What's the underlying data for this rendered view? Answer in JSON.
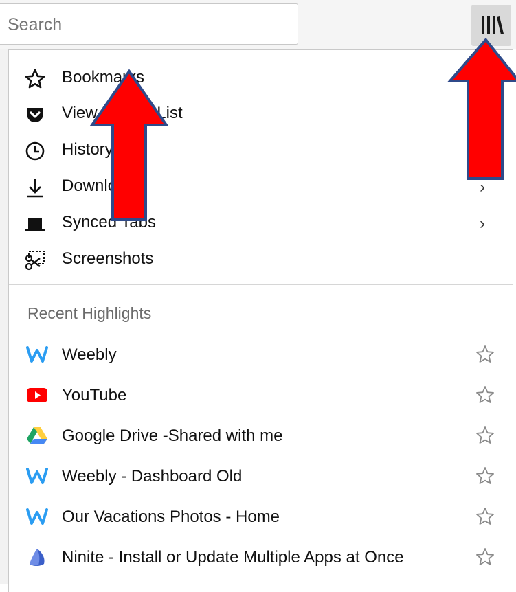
{
  "search": {
    "placeholder": "Search"
  },
  "toolbar": {
    "library_icon": "library-icon"
  },
  "menu": {
    "items": [
      {
        "label": "Bookmarks",
        "icon": "star-outline-icon",
        "has_submenu": false
      },
      {
        "label": "View Pocket List",
        "icon": "pocket-icon",
        "has_submenu": false
      },
      {
        "label": "History",
        "icon": "clock-icon",
        "has_submenu": false
      },
      {
        "label": "Downloads",
        "icon": "download-icon",
        "has_submenu": true
      },
      {
        "label": "Synced Tabs",
        "icon": "synced-tabs-icon",
        "has_submenu": true
      },
      {
        "label": "Screenshots",
        "icon": "screenshot-icon",
        "has_submenu": false
      }
    ]
  },
  "highlights": {
    "title": "Recent Highlights",
    "items": [
      {
        "title": "Weebly",
        "favicon": "weebly-icon",
        "accent": "#2b9df2"
      },
      {
        "title": "YouTube",
        "favicon": "youtube-icon",
        "accent": "#ff0000"
      },
      {
        "title": "Google Drive -Shared with me",
        "favicon": "google-drive-icon",
        "accent": "#1fa463"
      },
      {
        "title": "Weebly - Dashboard Old",
        "favicon": "weebly-icon",
        "accent": "#2b9df2"
      },
      {
        "title": "Our Vacations Photos - Home",
        "favicon": "weebly-icon",
        "accent": "#2b9df2"
      },
      {
        "title": "Ninite - Install or Update Multiple Apps at Once",
        "favicon": "ninite-icon",
        "accent": "#3b5fc9"
      }
    ]
  },
  "annotations": {
    "arrow_color": "#ff0000",
    "arrow_outline": "#2f4a8a"
  }
}
